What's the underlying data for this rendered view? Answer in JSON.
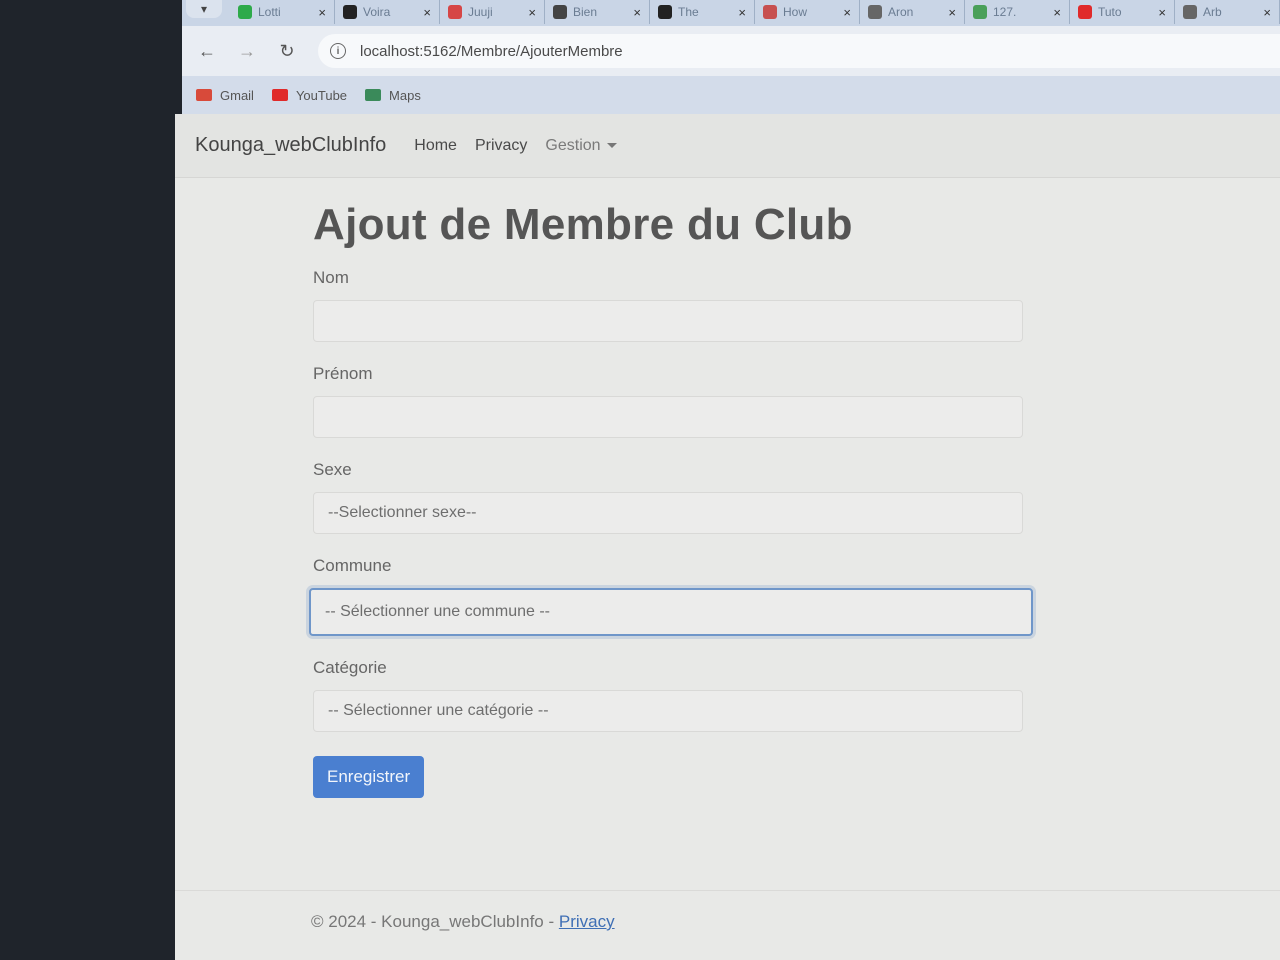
{
  "browser": {
    "tabs": [
      {
        "label": "Lotti",
        "icon": "check-icon",
        "color": "#2eaa4a"
      },
      {
        "label": "Voira",
        "icon": "a-icon",
        "color": "#222222"
      },
      {
        "label": "Juuji",
        "icon": "js-icon",
        "color": "#d64646"
      },
      {
        "label": "Bien",
        "icon": "react-icon",
        "color": "#444444"
      },
      {
        "label": "The",
        "icon": "dj-icon",
        "color": "#222222"
      },
      {
        "label": "How",
        "icon": "page-icon",
        "color": "#c75050"
      },
      {
        "label": "Aron",
        "icon": "doc-icon",
        "color": "#666666"
      },
      {
        "label": "127.",
        "icon": "globe-icon",
        "color": "#4aa05a"
      },
      {
        "label": "Tuto",
        "icon": "youtube-icon",
        "color": "#e02a2a"
      },
      {
        "label": "Arb",
        "icon": "doc-icon",
        "color": "#666666"
      }
    ],
    "url": "localhost:5162/Membre/AjouterMembre",
    "bookmarks": [
      {
        "label": "Gmail",
        "icon": "gmail-icon",
        "color": "#d84a3a"
      },
      {
        "label": "YouTube",
        "icon": "youtube-icon",
        "color": "#e02a2a"
      },
      {
        "label": "Maps",
        "icon": "maps-pin-icon",
        "color": "#3a8a5a"
      }
    ]
  },
  "navbar": {
    "brand": "Kounga_webClubInfo",
    "links": [
      "Home",
      "Privacy"
    ],
    "dropdown": "Gestion"
  },
  "form": {
    "title": "Ajout de Membre du Club",
    "nom_label": "Nom",
    "nom_value": "",
    "prenom_label": "Prénom",
    "prenom_value": "",
    "sexe_label": "Sexe",
    "sexe_selected": "--Selectionner sexe--",
    "commune_label": "Commune",
    "commune_selected": "-- Sélectionner une commune --",
    "categorie_label": "Catégorie",
    "categorie_selected": "-- Sélectionner une catégorie --",
    "submit_label": "Enregistrer"
  },
  "footer": {
    "text": "© 2024 - Kounga_webClubInfo - ",
    "link": "Privacy"
  }
}
